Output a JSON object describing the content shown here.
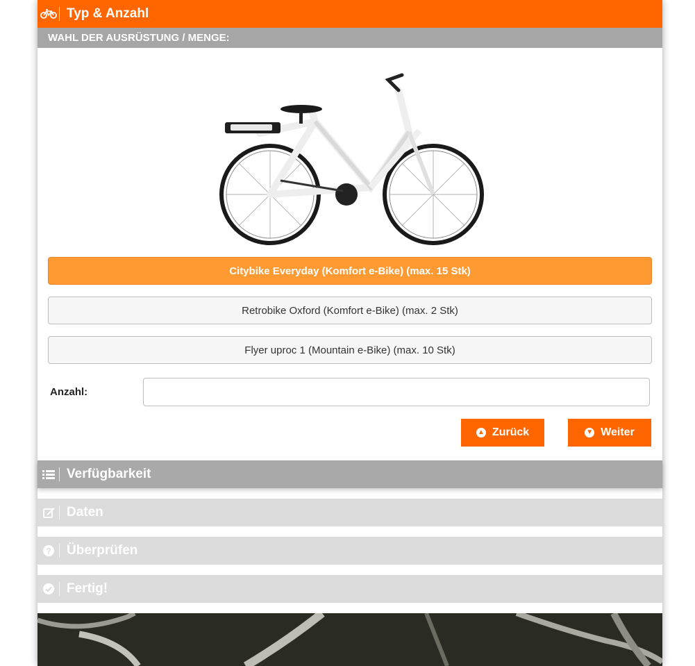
{
  "steps": {
    "type": {
      "title": "Typ & Anzahl",
      "icon": "bicycle-icon"
    },
    "availability": {
      "title": "Verfügbarkeit",
      "icon": "list-icon"
    },
    "data": {
      "title": "Daten",
      "icon": "edit-icon"
    },
    "review": {
      "title": "Überprüfen",
      "icon": "question-circle-icon"
    },
    "done": {
      "title": "Fertig!",
      "icon": "check-circle-icon"
    }
  },
  "section": {
    "subtitle": "WAHL DER AUSRÜSTUNG / MENGE:"
  },
  "equipment": {
    "options": [
      {
        "label": "Citybike Everyday (Komfort e-Bike) (max. 15 Stk)",
        "selected": true
      },
      {
        "label": "Retrobike Oxford (Komfort e-Bike) (max. 2 Stk)",
        "selected": false
      },
      {
        "label": "Flyer uproc 1 (Mountain e-Bike) (max. 10 Stk)",
        "selected": false
      }
    ]
  },
  "quantity": {
    "label": "Anzahl:",
    "value": ""
  },
  "actions": {
    "back_label": "Zurück",
    "next_label": "Weiter"
  },
  "colors": {
    "accent": "#ff6600",
    "selected": "#ff9a33",
    "inactive_header": "#a9a9a9",
    "disabled_header": "#dcdcdc"
  }
}
